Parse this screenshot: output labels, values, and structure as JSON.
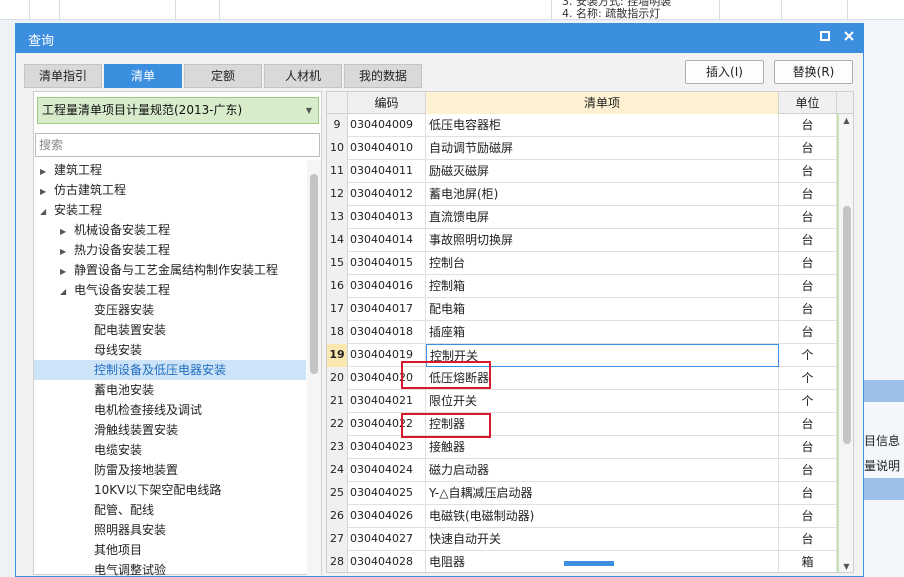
{
  "background": {
    "top_text": "3. 安装方式: 挂墙明装\n4. 名称: 疏散指示灯",
    "side_text_1": "目信息",
    "side_text_2": "量说明"
  },
  "dialog": {
    "title": "查询",
    "restore_icon": "restore-icon",
    "close_icon": "close-icon"
  },
  "tabs": [
    "清单指引",
    "清单",
    "定额",
    "人材机",
    "我的数据"
  ],
  "active_tab": 1,
  "buttons": {
    "insert": "插入(I)",
    "replace": "替换(R)"
  },
  "spec_select": {
    "value": "工程量清单项目计量规范(2013-广东)"
  },
  "search": {
    "placeholder": "搜索"
  },
  "tree": [
    {
      "label": "建筑工程",
      "level": 0,
      "expander": "▶"
    },
    {
      "label": "仿古建筑工程",
      "level": 0,
      "expander": "▶"
    },
    {
      "label": "安装工程",
      "level": 0,
      "expander": "◢"
    },
    {
      "label": "机械设备安装工程",
      "level": 1,
      "expander": "▶"
    },
    {
      "label": "热力设备安装工程",
      "level": 1,
      "expander": "▶"
    },
    {
      "label": "静置设备与工艺金属结构制作安装工程",
      "level": 1,
      "expander": "▶"
    },
    {
      "label": "电气设备安装工程",
      "level": 1,
      "expander": "◢"
    },
    {
      "label": "变压器安装",
      "level": 2,
      "expander": ""
    },
    {
      "label": "配电装置安装",
      "level": 2,
      "expander": ""
    },
    {
      "label": "母线安装",
      "level": 2,
      "expander": ""
    },
    {
      "label": "控制设备及低压电器安装",
      "level": 2,
      "expander": "",
      "selected": true
    },
    {
      "label": "蓄电池安装",
      "level": 2,
      "expander": ""
    },
    {
      "label": "电机检查接线及调试",
      "level": 2,
      "expander": ""
    },
    {
      "label": "滑触线装置安装",
      "level": 2,
      "expander": ""
    },
    {
      "label": "电缆安装",
      "level": 2,
      "expander": ""
    },
    {
      "label": "防雷及接地装置",
      "level": 2,
      "expander": ""
    },
    {
      "label": "10KV以下架空配电线路",
      "level": 2,
      "expander": ""
    },
    {
      "label": "配管、配线",
      "level": 2,
      "expander": ""
    },
    {
      "label": "照明器具安装",
      "level": 2,
      "expander": ""
    },
    {
      "label": "其他项目",
      "level": 2,
      "expander": ""
    },
    {
      "label": "电气调整试验",
      "level": 2,
      "expander": ""
    }
  ],
  "grid": {
    "headers": {
      "no": "",
      "code": "编码",
      "item": "清单项",
      "unit": "单位"
    },
    "rows": [
      {
        "no": "9",
        "code": "030404009",
        "item": "低压电容器柜",
        "unit": "台"
      },
      {
        "no": "10",
        "code": "030404010",
        "item": "自动调节励磁屏",
        "unit": "台"
      },
      {
        "no": "11",
        "code": "030404011",
        "item": "励磁灭磁屏",
        "unit": "台"
      },
      {
        "no": "12",
        "code": "030404012",
        "item": "蓄电池屏(柜)",
        "unit": "台"
      },
      {
        "no": "13",
        "code": "030404013",
        "item": "直流馈电屏",
        "unit": "台"
      },
      {
        "no": "14",
        "code": "030404014",
        "item": "事故照明切换屏",
        "unit": "台"
      },
      {
        "no": "15",
        "code": "030404015",
        "item": "控制台",
        "unit": "台"
      },
      {
        "no": "16",
        "code": "030404016",
        "item": "控制箱",
        "unit": "台"
      },
      {
        "no": "17",
        "code": "030404017",
        "item": "配电箱",
        "unit": "台"
      },
      {
        "no": "18",
        "code": "030404018",
        "item": "插座箱",
        "unit": "台"
      },
      {
        "no": "19",
        "code": "030404019",
        "item": "控制开关",
        "unit": "个",
        "selected": true
      },
      {
        "no": "20",
        "code": "030404020",
        "item": "低压熔断器",
        "unit": "个"
      },
      {
        "no": "21",
        "code": "030404021",
        "item": "限位开关",
        "unit": "个"
      },
      {
        "no": "22",
        "code": "030404022",
        "item": "控制器",
        "unit": "台"
      },
      {
        "no": "23",
        "code": "030404023",
        "item": "接触器",
        "unit": "台"
      },
      {
        "no": "24",
        "code": "030404024",
        "item": "磁力启动器",
        "unit": "台"
      },
      {
        "no": "25",
        "code": "030404025",
        "item": "Y-△自耦减压启动器",
        "unit": "台"
      },
      {
        "no": "26",
        "code": "030404026",
        "item": "电磁铁(电磁制动器)",
        "unit": "台"
      },
      {
        "no": "27",
        "code": "030404027",
        "item": "快速自动开关",
        "unit": "台"
      },
      {
        "no": "28",
        "code": "030404028",
        "item": "电阻器",
        "unit": "箱"
      }
    ]
  },
  "colors": {
    "accent": "#3c8ede",
    "annotation": "#d9182d",
    "select_bg": "#d7eccb"
  }
}
